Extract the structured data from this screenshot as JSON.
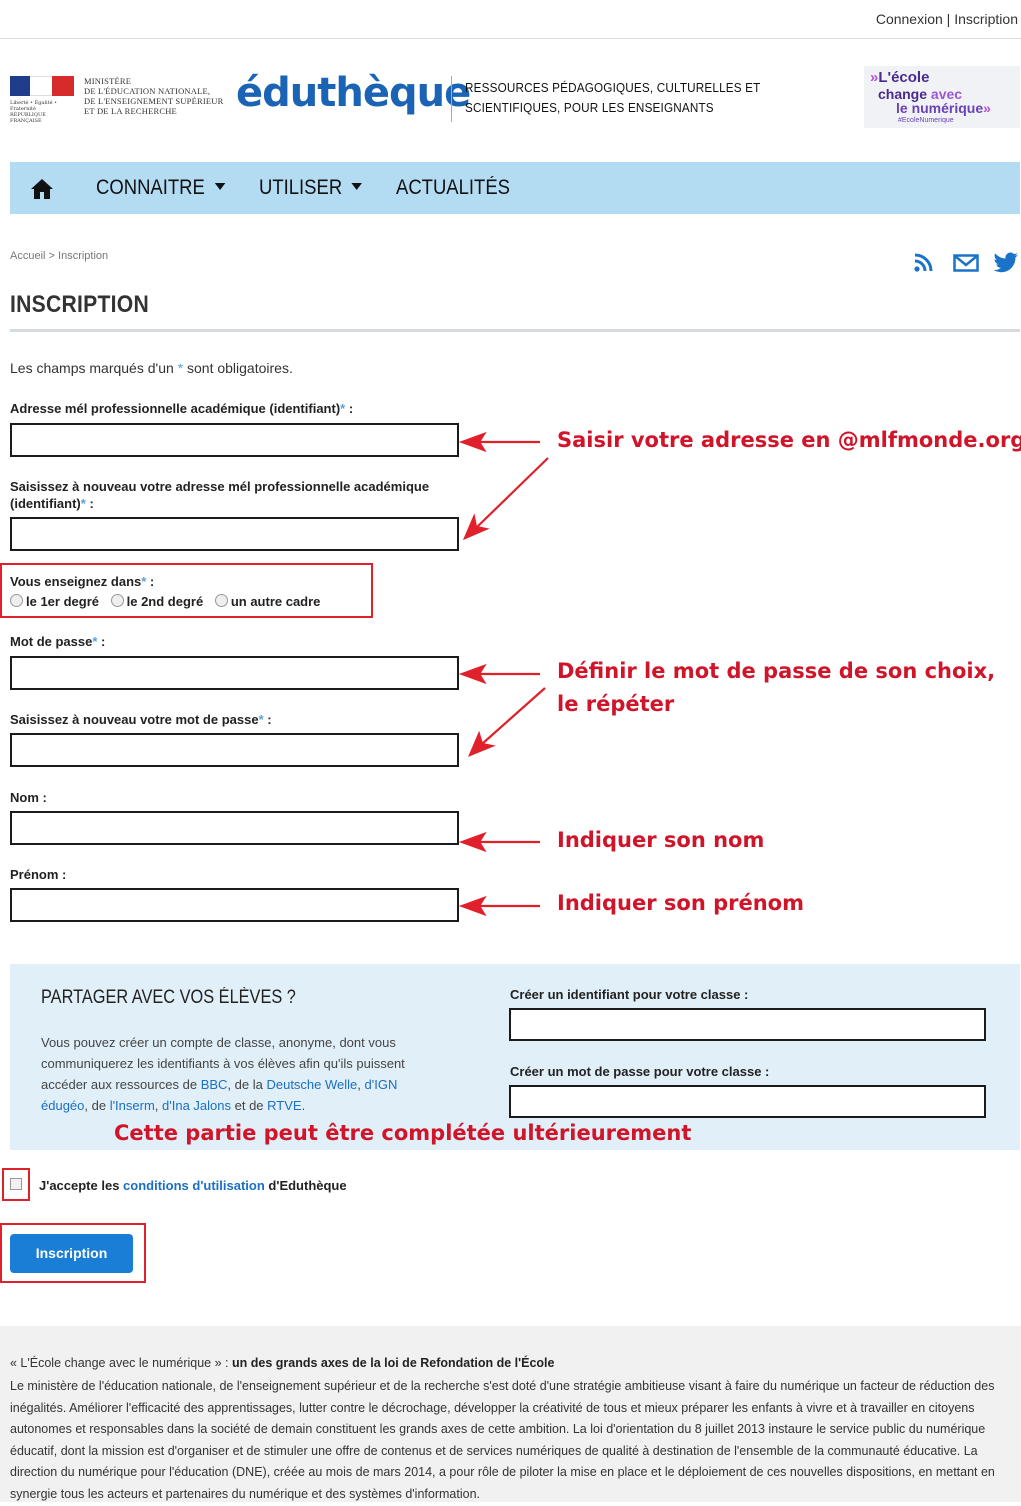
{
  "topbar": {
    "login": "Connexion",
    "separator": "|",
    "register": "Inscription"
  },
  "header": {
    "ministry_lines": [
      "MINISTÈRE",
      "DE L'ÉDUCATION NATIONALE,",
      "DE L'ENSEIGNEMENT SUPÉRIEUR",
      "ET DE LA RECHERCHE"
    ],
    "republic_motto": "Liberté • Égalité • Fraternité",
    "republic_name": "RÉPUBLIQUE FRANÇAISE",
    "logo": "éduthèque",
    "tagline_line1": "RESSOURCES PÉDAGOGIQUES, CULTURELLES ET",
    "tagline_line2": "SCIENTIFIQUES, POUR LES ENSEIGNANTS",
    "badge_line1": "L'école",
    "badge_line2a": "change ",
    "badge_line2b": "avec",
    "badge_line3": "le numérique",
    "badge_hashtag": "#EcoleNumerique"
  },
  "nav": {
    "items": [
      "CONNAITRE",
      "UTILISER",
      "ACTUALITÉS"
    ]
  },
  "breadcrumb": {
    "home": "Accueil",
    "sep": " > ",
    "current": "Inscription"
  },
  "page": {
    "title": "INSCRIPTION",
    "required_before": "Les champs marqués d'un ",
    "required_star": "*",
    "required_after": " sont obligatoires."
  },
  "form": {
    "email_label": "Adresse mél professionnelle académique (identifiant)",
    "email_value": "",
    "email_confirm_label": "Saisissez à nouveau votre adresse mél professionnelle académique (identifiant)",
    "email_confirm_value": "",
    "teach_label": "Vous enseignez dans",
    "teach_options": [
      "le 1er degré",
      "le 2nd degré",
      "un autre cadre"
    ],
    "password_label": "Mot de passe",
    "password_value": "",
    "password_confirm_label": "Saisissez à nouveau votre mot de passe",
    "password_confirm_value": "",
    "lastname_label": "Nom :",
    "lastname_value": "",
    "firstname_label": "Prénom :",
    "firstname_value": "",
    "star": "*",
    "colon": " :"
  },
  "annotations": {
    "email": "Saisir votre adresse en @mlfmonde.org",
    "password_line1": "Définir le mot de passe de son choix,",
    "password_line2": "le répéter",
    "lastname": "Indiquer son nom",
    "firstname": "Indiquer son prénom",
    "share": "Cette partie peut être complétée ultérieurement"
  },
  "share": {
    "title": "PARTAGER AVEC VOS ÉLÈVES ?",
    "desc_1": "Vous pouvez créer un compte de classe, anonyme, dont vous communiquerez les identifiants à vos élèves afin qu'ils puissent accéder aux ressources de ",
    "link_bbc": "BBC",
    "desc_2": ", de la ",
    "link_dw": "Deutsche Welle",
    "desc_3": ", ",
    "link_ign": "d'IGN édugéo",
    "desc_4": ", de ",
    "link_inserm": "l'Inserm",
    "desc_5": ", ",
    "link_ina": "d'Ina Jalons",
    "desc_6": " et de ",
    "link_rtve": "RTVE",
    "desc_7": ".",
    "class_id_label": "Créer un identifiant pour votre classe :",
    "class_id_value": "",
    "class_pw_label": "Créer un mot de passe pour votre classe :",
    "class_pw_value": ""
  },
  "accept": {
    "before": "J'accepte les ",
    "link": "conditions d'utilisation",
    "after": " d'Eduthèque"
  },
  "submit": {
    "label": "Inscription"
  },
  "footer": {
    "heading_quote": "« L'École change avec le numérique » : ",
    "heading_bold": "un des grands axes de la loi de Refondation de l'École",
    "paragraph": "Le ministère de l'éducation nationale, de l'enseignement supérieur et de la recherche s'est doté d'une stratégie ambitieuse visant à faire du numérique un facteur de réduction des inégalités. Améliorer l'efficacité des apprentissages, lutter contre le décrochage, développer la créativité de tous et mieux préparer les enfants à vivre et à travailler en citoyens autonomes et responsables dans la société de demain constituent les grands axes de cette ambition. La loi d'orientation du 8 juillet 2013 instaure le service public du numérique éducatif, dont la mission est d'organiser et de stimuler une offre de contenus et de services numériques de qualité à destination de l'ensemble de la communauté éducative. La direction du numérique pour l'éducation (DNE), créée au mois de mars 2014, a pour rôle de piloter la mise en place et le déploiement de ces nouvelles dispositions, en mettant en synergie tous les acteurs et partenaires du numérique et des systèmes d'information."
  },
  "colors": {
    "nav_bg": "#b3dcf2",
    "brand_blue": "#1a63b5",
    "annotation_red": "#d0152a",
    "button_blue": "#1a7ed6",
    "share_bg": "#e1eff8"
  },
  "icons": [
    "home-icon",
    "rss-icon",
    "mail-icon",
    "twitter-icon",
    "caret-down-icon",
    "arrow-left-icon"
  ]
}
